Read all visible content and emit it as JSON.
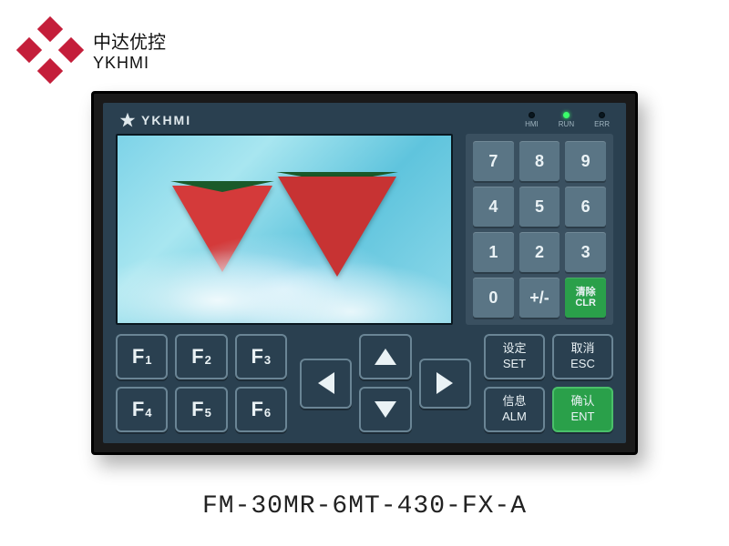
{
  "logo": {
    "cn": "中达优控",
    "en": "YKHMI"
  },
  "device": {
    "brand": "YKHMI",
    "leds": [
      {
        "label": "HMI",
        "on": false
      },
      {
        "label": "RUN",
        "on": true
      },
      {
        "label": "ERR",
        "on": false
      }
    ],
    "keypad": {
      "keys": [
        "7",
        "8",
        "9",
        "4",
        "5",
        "6",
        "1",
        "2",
        "3",
        "0",
        "+/-"
      ],
      "clr_cn": "清除",
      "clr_en": "CLR"
    },
    "fkeys": [
      "F1",
      "F2",
      "F3",
      "F4",
      "F5",
      "F6"
    ],
    "actions": {
      "set_cn": "设定",
      "set_en": "SET",
      "esc_cn": "取消",
      "esc_en": "ESC",
      "alm_cn": "信息",
      "alm_en": "ALM",
      "ent_cn": "确认",
      "ent_en": "ENT"
    }
  },
  "model": "FM-30MR-6MT-430-FX-A"
}
